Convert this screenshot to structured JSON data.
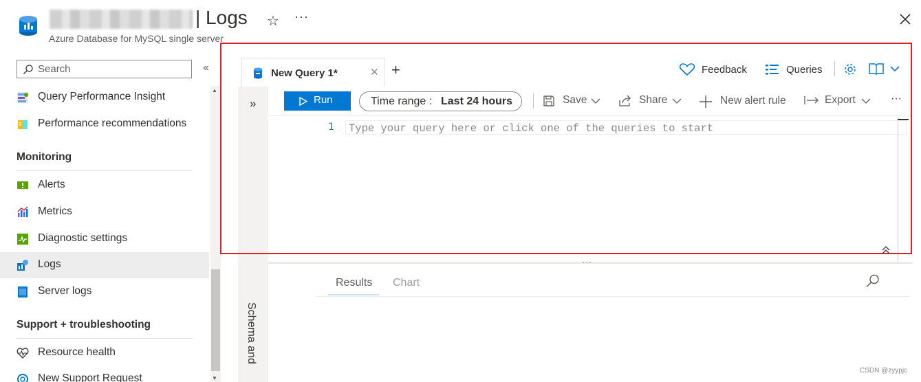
{
  "header": {
    "title": "| Logs",
    "subtitle": "Azure Database for MySQL single server"
  },
  "sidebar": {
    "search_placeholder": "Search",
    "items_top": [
      {
        "label": "Query Performance Insight",
        "icon": "query-performance-icon"
      },
      {
        "label": "Performance recommendations",
        "icon": "performance-recommendations-icon"
      }
    ],
    "monitoring": {
      "title": "Monitoring",
      "items": [
        {
          "label": "Alerts",
          "icon": "alerts-icon"
        },
        {
          "label": "Metrics",
          "icon": "metrics-icon"
        },
        {
          "label": "Diagnostic settings",
          "icon": "diagnostic-settings-icon"
        },
        {
          "label": "Logs",
          "icon": "logs-icon",
          "active": true
        },
        {
          "label": "Server logs",
          "icon": "server-logs-icon"
        }
      ]
    },
    "support": {
      "title": "Support + troubleshooting",
      "items": [
        {
          "label": "Resource health",
          "icon": "resource-health-icon"
        },
        {
          "label": "New Support Request",
          "icon": "support-request-icon"
        }
      ]
    }
  },
  "logs": {
    "tab_label": "New Query 1*",
    "top_actions": {
      "feedback": "Feedback",
      "queries": "Queries"
    },
    "toolbar": {
      "run": "Run",
      "time_range_key": "Time range :",
      "time_range_value": "Last 24 hours",
      "save": "Save",
      "share": "Share",
      "new_alert_rule": "New alert rule",
      "export": "Export"
    },
    "editor": {
      "line_number": "1",
      "placeholder": "Type your query here or click one of the queries to start"
    },
    "schema_label": "Schema and",
    "results_tabs": {
      "results": "Results",
      "chart": "Chart"
    }
  },
  "watermark": "CSDN @zyypjc",
  "colors": {
    "accent": "#0078d4",
    "highlight_frame": "#e02020"
  }
}
